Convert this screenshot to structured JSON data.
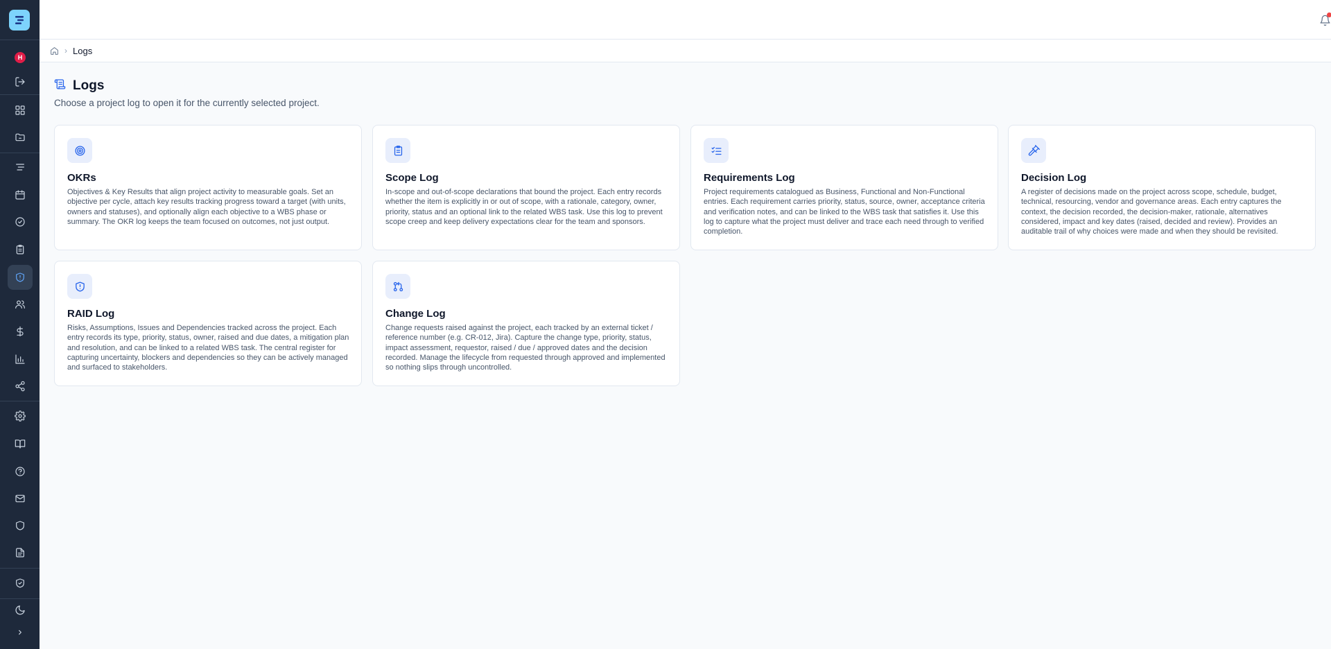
{
  "user": {
    "initial": "H"
  },
  "sidebar": {
    "icons": [
      "logout-icon",
      "dashboard-icon",
      "folder-icon",
      "wbs-icon",
      "calendar-icon",
      "check-circle-icon",
      "clipboard-icon",
      "logs-shield-icon",
      "users-icon",
      "dollar-icon",
      "chart-icon",
      "share-icon",
      "settings-icon",
      "book-icon",
      "help-icon",
      "mail-icon",
      "shield-icon",
      "document-icon",
      "shield-check-icon",
      "moon-icon",
      "chevron-right-icon"
    ],
    "active_item": "logs-shield-icon"
  },
  "breadcrumb": {
    "current": "Logs"
  },
  "page": {
    "title": "Logs",
    "subtitle": "Choose a project log to open it for the currently selected project."
  },
  "cards": [
    {
      "icon": "target-icon",
      "title": "OKRs",
      "description": "Objectives & Key Results that align project activity to measurable goals. Set an objective per cycle, attach key results tracking progress toward a target (with units, owners and statuses), and optionally align each objective to a WBS phase or summary. The OKR log keeps the team focused on outcomes, not just output."
    },
    {
      "icon": "clipboard-icon",
      "title": "Scope Log",
      "description": "In-scope and out-of-scope declarations that bound the project. Each entry records whether the item is explicitly in or out of scope, with a rationale, category, owner, priority, status and an optional link to the related WBS task. Use this log to prevent scope creep and keep delivery expectations clear for the team and sponsors."
    },
    {
      "icon": "checklist-icon",
      "title": "Requirements Log",
      "description": "Project requirements catalogued as Business, Functional and Non-Functional entries. Each requirement carries priority, status, source, owner, acceptance criteria and verification notes, and can be linked to the WBS task that satisfies it. Use this log to capture what the project must deliver and trace each need through to verified completion."
    },
    {
      "icon": "gavel-icon",
      "title": "Decision Log",
      "description": "A register of decisions made on the project across scope, schedule, budget, technical, resourcing, vendor and governance areas. Each entry captures the context, the decision recorded, the decision-maker, rationale, alternatives considered, impact and key dates (raised, decided and review). Provides an auditable trail of why choices were made and when they should be revisited."
    },
    {
      "icon": "shield-alert-icon",
      "title": "RAID Log",
      "description": "Risks, Assumptions, Issues and Dependencies tracked across the project. Each entry records its type, priority, status, owner, raised and due dates, a mitigation plan and resolution, and can be linked to a related WBS task. The central register for capturing uncertainty, blockers and dependencies so they can be actively managed and surfaced to stakeholders."
    },
    {
      "icon": "git-pull-request-icon",
      "title": "Change Log",
      "description": "Change requests raised against the project, each tracked by an external ticket / reference number (e.g. CR-012, Jira). Capture the change type, priority, status, impact assessment, requestor, raised / due / approved dates and the decision recorded. Manage the lifecycle from requested through approved and implemented so nothing slips through uncontrolled."
    }
  ],
  "colors": {
    "sidebar_bg": "#1e293b",
    "accent": "#2563eb",
    "avatar": "#e11d48",
    "notification_dot": "#ef4444"
  }
}
